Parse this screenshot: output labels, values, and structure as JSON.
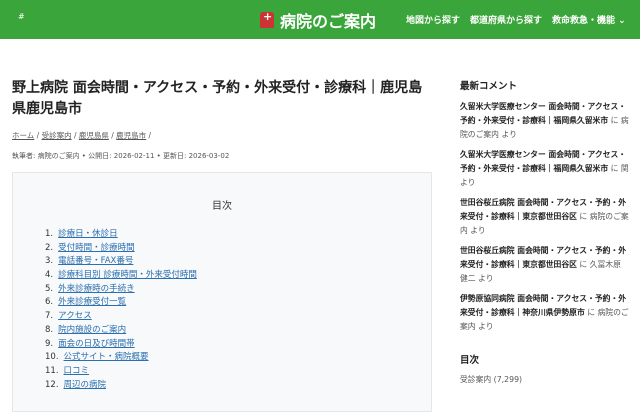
{
  "header": {
    "hash": "#",
    "site_title": "病院のご案内",
    "nav": [
      "地図から探す",
      "都道府県から探す",
      "救命救急・機能 ⌄"
    ],
    "bg_color": "#3aa53a"
  },
  "article": {
    "title": "野上病院 面会時間・アクセス・予約・外来受付・診療科｜鹿児島県鹿児島市",
    "breadcrumb": [
      "ホーム",
      "受診案内",
      "鹿児島県",
      "鹿児島市"
    ],
    "meta": "執筆者: 病院のご案内 • 公開日: 2026-02-11 • 更新日: 2026-03-02"
  },
  "toc": {
    "title": "目次",
    "items": [
      {
        "n": "1.",
        "label": "診療日・休診日"
      },
      {
        "n": "2.",
        "label": "受付時間・診療時間"
      },
      {
        "n": "3.",
        "label": "電話番号・FAX番号"
      },
      {
        "n": "4.",
        "label": "診療科目別 診療時間・外来受付時間"
      },
      {
        "n": "5.",
        "label": "外来診療時の手続き"
      },
      {
        "n": "6.",
        "label": "外来診療受付一覧"
      },
      {
        "n": "7.",
        "label": "アクセス"
      },
      {
        "n": "8.",
        "label": "院内施設のご案内"
      },
      {
        "n": "9.",
        "label": "面会の日及び時間帯"
      },
      {
        "n": "10.",
        "label": "公式サイト・病院概要"
      },
      {
        "n": "11.",
        "label": "口コミ"
      },
      {
        "n": "12.",
        "label": "周辺の病院"
      }
    ]
  },
  "sidebar": {
    "recent_title": "最新コメント",
    "comments": [
      {
        "post": "久留米大学医療センター 面会時間・アクセス・予約・外来受付・診療科｜福岡県久留米市",
        "by": " に 病院のご案内 より"
      },
      {
        "post": "久留米大学医療センター 面会時間・アクセス・予約・外来受付・診療科｜福岡県久留米市",
        "by": " に 関 より"
      },
      {
        "post": "世田谷桜丘病院 面会時間・アクセス・予約・外来受付・診療科｜東京都世田谷区",
        "by": " に 病院のご案内 より"
      },
      {
        "post": "世田谷桜丘病院 面会時間・アクセス・予約・外来受付・診療科｜東京都世田谷区",
        "by": " に 久冨木原　健二 より"
      },
      {
        "post": "伊勢原協同病院 面会時間・アクセス・予約・外来受付・診療科｜神奈川県伊勢原市",
        "by": " に 病院のご案内 より"
      }
    ],
    "toc_title": "目次",
    "category": "受診案内 (7,299)"
  }
}
